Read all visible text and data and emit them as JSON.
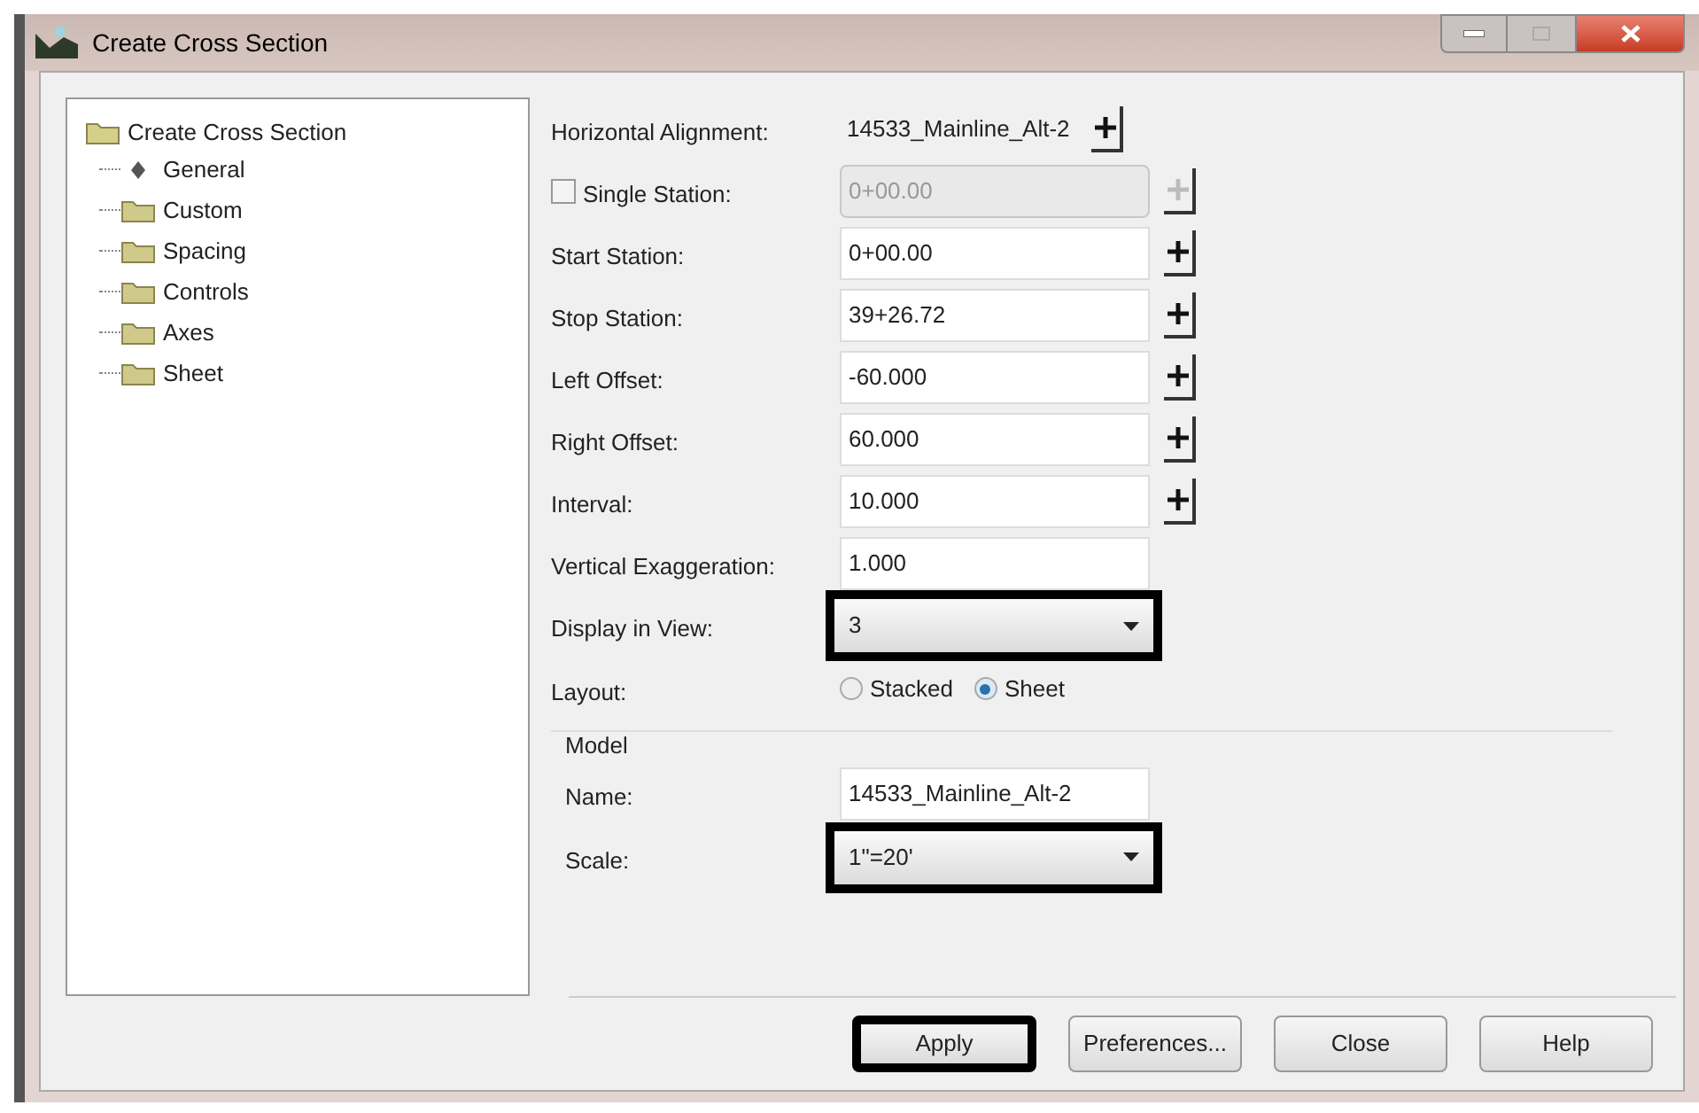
{
  "window": {
    "title": "Create Cross Section"
  },
  "tree": {
    "label": "Create Cross Section",
    "children": [
      {
        "label": "General",
        "kind": "arrow"
      },
      {
        "label": "Custom",
        "kind": "folder"
      },
      {
        "label": "Spacing",
        "kind": "folder"
      },
      {
        "label": "Controls",
        "kind": "folder"
      },
      {
        "label": "Axes",
        "kind": "folder"
      },
      {
        "label": "Sheet",
        "kind": "folder"
      }
    ]
  },
  "rows": [
    {
      "kind": "readout",
      "label": "Horizontal Alignment:",
      "value": "14533_Mainline_Alt-2",
      "pick": true
    },
    {
      "kind": "checkbox",
      "label": "Single Station:",
      "checked": false,
      "value": "0+00.00",
      "pick": true,
      "disabled": true
    },
    {
      "kind": "input",
      "label": "Start Station:",
      "value": "0+00.00",
      "pick": true,
      "disabled": false
    },
    {
      "kind": "input",
      "label": "Stop Station:",
      "value": "39+26.72",
      "pick": true,
      "disabled": false
    },
    {
      "kind": "input",
      "label": "Left Offset:",
      "value": "-60.000",
      "pick": true,
      "disabled": false
    },
    {
      "kind": "input",
      "label": "Right Offset:",
      "value": "60.000",
      "pick": true,
      "disabled": false
    },
    {
      "kind": "input",
      "label": "Interval:",
      "value": "10.000",
      "pick": true,
      "disabled": false
    },
    {
      "kind": "input",
      "label": "Vertical Exaggeration:",
      "value": "1.000",
      "pick": false,
      "disabled": false
    },
    {
      "kind": "dropdown",
      "label": "Display in View:",
      "value": "3",
      "highlighted": true
    },
    {
      "kind": "radio",
      "label": "Layout:",
      "options": [
        {
          "label": "Stacked",
          "selected": false
        },
        {
          "label": "Sheet",
          "selected": true
        }
      ]
    }
  ],
  "model_group": {
    "title": "Model",
    "rows": [
      {
        "kind": "input",
        "label": "Name:",
        "value": "14533_Mainline_Alt-2",
        "pick": false,
        "disabled": false
      },
      {
        "kind": "dropdown",
        "label": "Scale:",
        "value": "1\"=20'",
        "highlighted": true
      }
    ]
  },
  "buttons": [
    {
      "label": "Apply",
      "highlighted": true
    },
    {
      "label": "Preferences...",
      "highlighted": false
    },
    {
      "label": "Close",
      "highlighted": false
    },
    {
      "label": "Help",
      "highlighted": false
    }
  ]
}
